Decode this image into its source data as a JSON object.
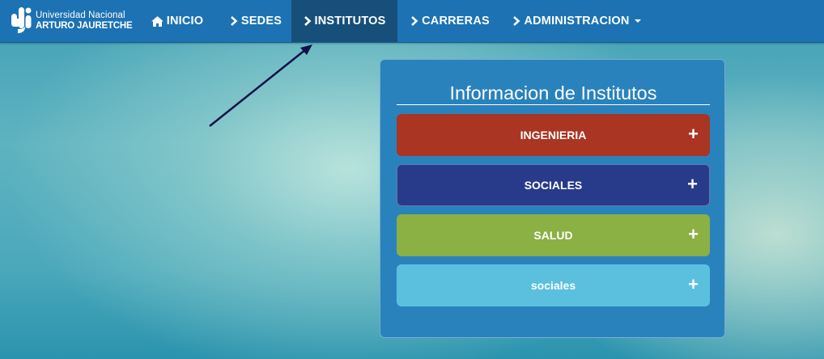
{
  "brand": {
    "line1": "Universidad Nacional",
    "line2": "ARTURO JAURETCHE",
    "icon": "university-logo"
  },
  "nav": {
    "items": [
      {
        "label": "INICIO",
        "icon": "home-icon",
        "active": false
      },
      {
        "label": "SEDES",
        "icon": "chevron-right-icon",
        "active": false
      },
      {
        "label": "INSTITUTOS",
        "icon": "chevron-right-icon",
        "active": true
      },
      {
        "label": "CARRERAS",
        "icon": "chevron-right-icon",
        "active": false
      },
      {
        "label": "ADMINISTRACION",
        "icon": "chevron-right-icon",
        "active": false,
        "dropdown": true
      }
    ]
  },
  "panel": {
    "title": "Informacion de Institutos",
    "items": [
      {
        "label": "INGENIERIA",
        "color": "#a93522",
        "toggle": "+"
      },
      {
        "label": "SOCIALES",
        "color": "#283b8a",
        "toggle": "+"
      },
      {
        "label": "SALUD",
        "color": "#8bb043",
        "toggle": "+"
      },
      {
        "label": "sociales",
        "color": "#5bc0de",
        "toggle": "+"
      }
    ]
  },
  "colors": {
    "navbar": "#1c72b3",
    "nav_active": "#164f7a",
    "panel": "#2a82bd",
    "annotation_arrow": "#12114a"
  }
}
